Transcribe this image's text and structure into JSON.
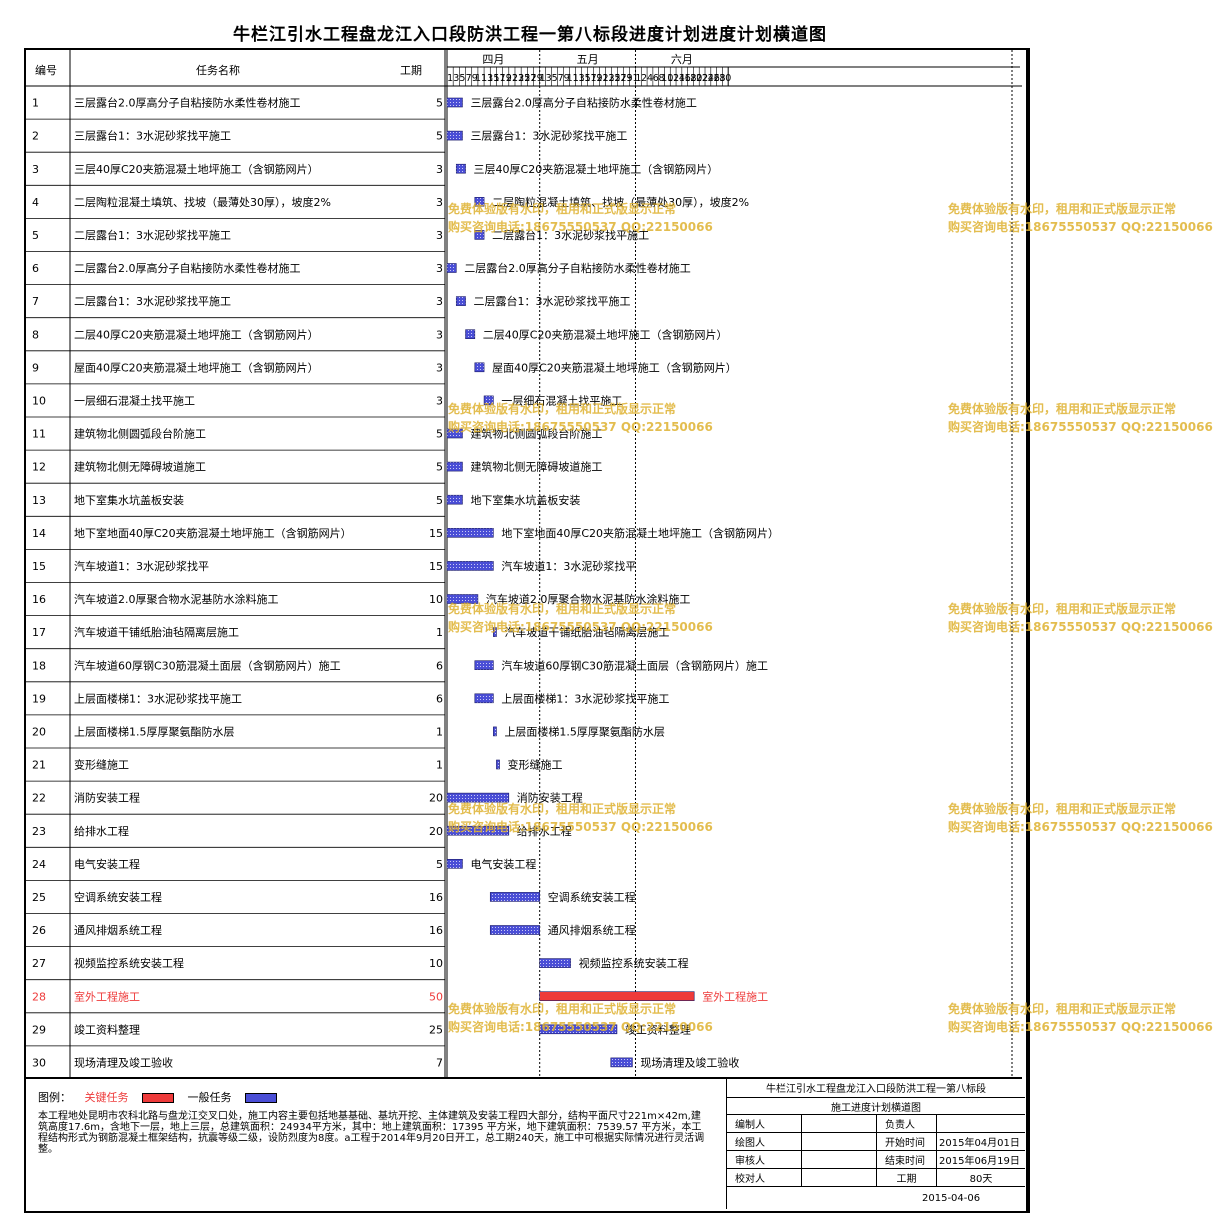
{
  "page": {
    "title": "牛栏江引水工程盘龙江入口段防洪工程一第八标段进度计划进度计划横道图"
  },
  "colors": {
    "critical": "#ee3a3a",
    "normal": "#4a4ed6",
    "watermark": "#deb230"
  },
  "chart_data": {
    "type": "gantt",
    "columns": {
      "id": "编号",
      "name": "任务名称",
      "duration": "工期"
    },
    "months": [
      {
        "label": "四月",
        "days": [
          1,
          3,
          5,
          7,
          9,
          11,
          13,
          15,
          17,
          19,
          21,
          23,
          25,
          27,
          29
        ]
      },
      {
        "label": "五月",
        "days": [
          1,
          3,
          5,
          7,
          9,
          11,
          13,
          15,
          17,
          19,
          21,
          23,
          25,
          27,
          29,
          31
        ]
      },
      {
        "label": "六月",
        "days": [
          1,
          2,
          4,
          6,
          8,
          10,
          12,
          14,
          16,
          18,
          20,
          22,
          24,
          26,
          28,
          30
        ]
      }
    ],
    "tasks": [
      {
        "id": "1",
        "name": "三层露台2.0厚高分子自粘接防水柔性卷材施工",
        "duration": 5,
        "start": "04-01",
        "critical": false
      },
      {
        "id": "2",
        "name": "三层露台1：3水泥砂浆找平施工",
        "duration": 5,
        "start": "04-01",
        "critical": false
      },
      {
        "id": "3",
        "name": "三层40厚C20夹筋混凝土地坪施工（含钢筋网片）",
        "duration": 3,
        "start": "04-04",
        "critical": false
      },
      {
        "id": "4",
        "name": "二层陶粒混凝土填筑、找坡（最薄处30厚），坡度2%",
        "duration": 3,
        "start": "04-10",
        "critical": false
      },
      {
        "id": "5",
        "name": "二层露台1：3水泥砂浆找平施工",
        "duration": 3,
        "start": "04-10",
        "critical": false
      },
      {
        "id": "6",
        "name": "二层露台2.0厚高分子自粘接防水柔性卷材施工",
        "duration": 3,
        "start": "04-01",
        "critical": false
      },
      {
        "id": "7",
        "name": "二层露台1：3水泥砂浆找平施工",
        "duration": 3,
        "start": "04-04",
        "critical": false
      },
      {
        "id": "8",
        "name": "二层40厚C20夹筋混凝土地坪施工（含钢筋网片）",
        "duration": 3,
        "start": "04-07",
        "critical": false
      },
      {
        "id": "9",
        "name": "屋面40厚C20夹筋混凝土地坪施工（含钢筋网片）",
        "duration": 3,
        "start": "04-10",
        "critical": false
      },
      {
        "id": "10",
        "name": "一层细石混凝土找平施工",
        "duration": 3,
        "start": "04-13",
        "critical": false
      },
      {
        "id": "11",
        "name": "建筑物北侧圆弧段台阶施工",
        "duration": 5,
        "start": "04-01",
        "critical": false
      },
      {
        "id": "12",
        "name": "建筑物北侧无障碍坡道施工",
        "duration": 5,
        "start": "04-01",
        "critical": false
      },
      {
        "id": "13",
        "name": "地下室集水坑盖板安装",
        "duration": 5,
        "start": "04-01",
        "critical": false
      },
      {
        "id": "14",
        "name": "地下室地面40厚C20夹筋混凝土地坪施工（含钢筋网片）",
        "duration": 15,
        "start": "04-01",
        "critical": false
      },
      {
        "id": "15",
        "name": "汽车坡道1：3水泥砂浆找平",
        "duration": 15,
        "start": "04-01",
        "critical": false
      },
      {
        "id": "16",
        "name": "汽车坡道2.0厚聚合物水泥基防水涂料施工",
        "duration": 10,
        "start": "04-01",
        "critical": false
      },
      {
        "id": "17",
        "name": "汽车坡道干铺纸胎油毡隔离层施工",
        "duration": 1,
        "start": "04-16",
        "critical": false
      },
      {
        "id": "18",
        "name": "汽车坡道60厚钢C30筋混凝土面层（含钢筋网片）施工",
        "duration": 6,
        "start": "04-10",
        "critical": false
      },
      {
        "id": "19",
        "name": "上层面楼梯1：3水泥砂浆找平施工",
        "duration": 6,
        "start": "04-10",
        "critical": false
      },
      {
        "id": "20",
        "name": "上层面楼梯1.5厚厚聚氨酯防水层",
        "duration": 1,
        "start": "04-16",
        "critical": false
      },
      {
        "id": "21",
        "name": "变形缝施工",
        "duration": 1,
        "start": "04-17",
        "critical": false
      },
      {
        "id": "22",
        "name": "消防安装工程",
        "duration": 20,
        "start": "04-01",
        "critical": false
      },
      {
        "id": "23",
        "name": "给排水工程",
        "duration": 20,
        "start": "04-01",
        "critical": false
      },
      {
        "id": "24",
        "name": "电气安装工程",
        "duration": 5,
        "start": "04-01",
        "critical": false
      },
      {
        "id": "25",
        "name": "空调系统安装工程",
        "duration": 16,
        "start": "04-15",
        "critical": false
      },
      {
        "id": "26",
        "name": "通风排烟系统工程",
        "duration": 16,
        "start": "04-15",
        "critical": false
      },
      {
        "id": "27",
        "name": "视频监控系统安装工程",
        "duration": 10,
        "start": "05-01",
        "critical": false
      },
      {
        "id": "28",
        "name": "室外工程施工",
        "duration": 50,
        "start": "05-01",
        "critical": true
      },
      {
        "id": "29",
        "name": "竣工资料整理",
        "duration": 25,
        "start": "05-01",
        "critical": false
      },
      {
        "id": "30",
        "name": "现场清理及竣工验收",
        "duration": 7,
        "start": "05-24",
        "critical": false
      }
    ]
  },
  "legend": {
    "label": "图例：",
    "critical": "关键任务",
    "normal": "一般任务"
  },
  "description": "本工程地处昆明市农科北路与盘龙江交叉口处，施工内容主要包括地基基础、基坑开挖、主体建筑及安装工程四大部分，结构平面尺寸221m×42m,建筑高度17.6m，含地下一层，地上三层，总建筑面积：24934平方米，其中：地上建筑面积：17395 平方米，地下建筑面积：7539.57 平方米，本工程结构形式为钢筋混凝土框架结构，抗震等级二级，设防烈度为8度。a工程于2014年9月20日开工，总工期240天，施工中可根据实际情况进行灵活调整。",
  "title_block": {
    "project": "牛栏江引水工程盘龙江入口段防洪工程一第八标段",
    "subtitle": "施工进度计划横道图",
    "editor_label": "编制人",
    "owner_label": "负责人",
    "drawer_label": "绘图人",
    "start_label": "开始时间",
    "start_value": "2015年04月01日",
    "reviewer_label": "审核人",
    "end_label": "结束时间",
    "end_value": "2015年06月19日",
    "checker_label": "校对人",
    "duration_label": "工期",
    "duration_value": "80天",
    "date": "2015-04-06"
  },
  "watermark": {
    "line1": "免费体验版有水印，租用和正式版显示正常",
    "line2": "购买咨询电话:18675550537 QQ:22150066"
  }
}
